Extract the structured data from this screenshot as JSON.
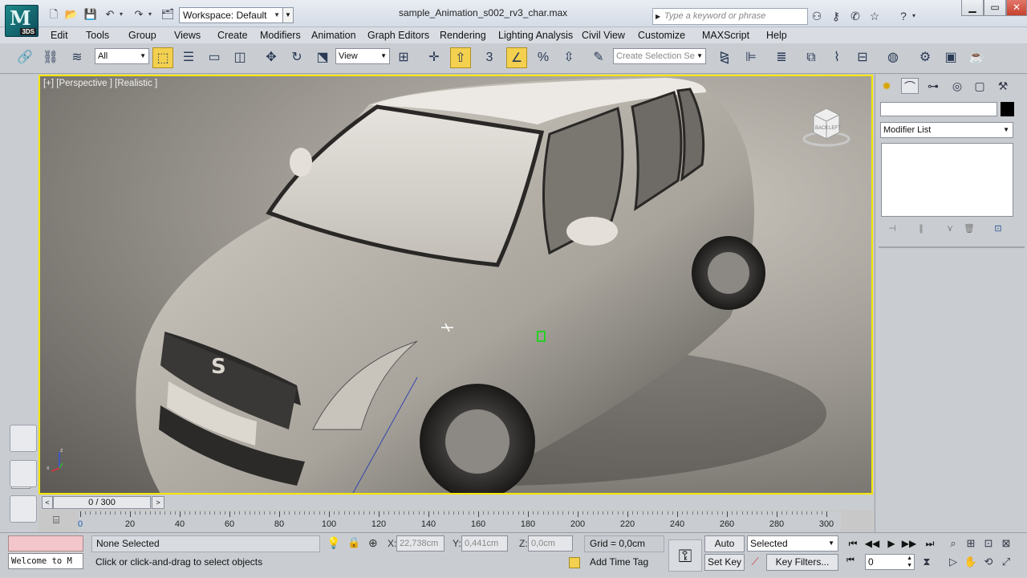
{
  "app": {
    "logo_text": "M",
    "logo_version": "3DS"
  },
  "title_bar": {
    "workspace": "Workspace: Default",
    "document_title": "sample_Animation_s002_rv3_char.max",
    "search_placeholder": "Type a keyword or phrase"
  },
  "menu": [
    "Edit",
    "Tools",
    "Group",
    "Views",
    "Create",
    "Modifiers",
    "Animation",
    "Graph Editors",
    "Rendering",
    "Lighting Analysis",
    "Civil View",
    "Customize",
    "MAXScript",
    "Help"
  ],
  "toolbar": {
    "selection_filter": "All",
    "ref_coord": "View",
    "snap_value": "3",
    "named_selection_placeholder": "Create Selection Se"
  },
  "viewport": {
    "label": "[+] [Perspective ] [Realistic ]",
    "viewcube_top": "BACK",
    "viewcube_side": "LEFT",
    "axis_x": "x",
    "axis_z": "z"
  },
  "command_panel": {
    "modifier_list": "Modifier List"
  },
  "timeline": {
    "slider_text": "0 / 300",
    "track_left": "<",
    "track_right": ">",
    "ruler_labels": [
      "0",
      "20",
      "40",
      "60",
      "80",
      "100",
      "120",
      "140",
      "160",
      "180",
      "200",
      "220",
      "240",
      "260",
      "280",
      "300"
    ]
  },
  "status": {
    "selection_status": "None Selected",
    "prompt": "Click or click-and-drag to select objects",
    "welcome": "Welcome to M",
    "x_label": "X:",
    "x_value": "22,738cm",
    "y_label": "Y:",
    "y_value": "0,441cm",
    "z_label": "Z:",
    "z_value": "0,0cm",
    "grid": "Grid = 0,0cm",
    "add_time_tag": "Add Time Tag",
    "auto_key": "Auto Key",
    "set_key": "Set Key",
    "key_mode": "Selected",
    "key_filters": "Key Filters...",
    "current_frame": "0"
  }
}
